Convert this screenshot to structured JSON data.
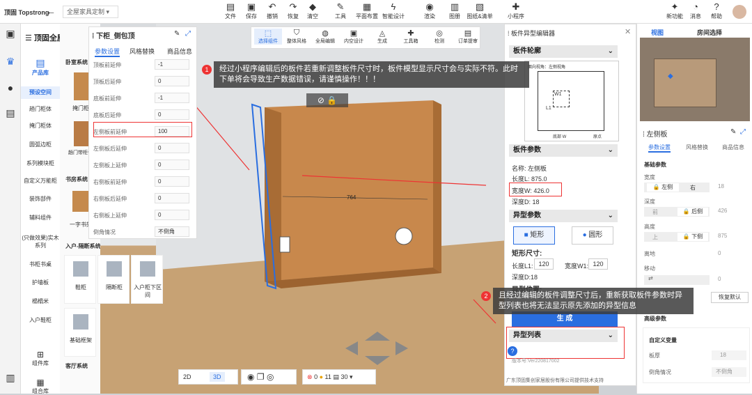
{
  "topbar": {
    "brand": "顶固 Topstrong",
    "back_icon": "arrow-left-icon",
    "breadcrumb": "全屋家具定制",
    "tools": [
      {
        "label": "文件",
        "icon": "file-icon"
      },
      {
        "label": "保存",
        "icon": "save-icon"
      },
      {
        "label": "撤销",
        "icon": "undo-icon"
      },
      {
        "label": "恢复",
        "icon": "redo-icon"
      },
      {
        "label": "清空",
        "icon": "clear-icon"
      },
      {
        "label": "工具",
        "icon": "wrench-icon"
      },
      {
        "label": "平面布置",
        "icon": "layout-icon"
      },
      {
        "label": "智能设计",
        "icon": "lightning-icon"
      },
      {
        "label": "渲染",
        "icon": "camera-icon"
      },
      {
        "label": "图册",
        "icon": "album-icon"
      },
      {
        "label": "图纸&清单",
        "icon": "drawings-icon"
      },
      {
        "label": "小程序",
        "icon": "puzzle-icon"
      }
    ],
    "right": [
      {
        "label": "新功能",
        "icon": "new-feature-icon"
      },
      {
        "label": "消息",
        "icon": "bell-icon"
      },
      {
        "label": "帮助",
        "icon": "help-icon"
      }
    ]
  },
  "left": {
    "title": "顶固全屋定制",
    "categories": [
      "产品库",
      "预设空间",
      "趟门柜体",
      "掩门柜体",
      "圆弧边柜",
      "系列模块柜",
      "自定义万能柜",
      "装饰部件",
      "辅料组件",
      "(只做效果)实木系列",
      "书柜书桌",
      "护墙板",
      "榻榻米",
      "入户鞋柜",
      "组件库",
      "组合库"
    ],
    "sections": [
      "卧室系统",
      "书房系统",
      "入户-隔断系统",
      "客厅系统"
    ],
    "products": [
      "掩门柜",
      "趟门带柜件",
      "一字书架",
      "鞋柜",
      "隔断柜",
      "入户柜下区间",
      "基础框架"
    ]
  },
  "param_panel": {
    "title": "下柜_侧包顶",
    "tabs": [
      "参数设置",
      "风格替换",
      "商品信息"
    ],
    "rows": [
      {
        "label": "顶板前延伸",
        "value": "-1"
      },
      {
        "label": "顶板后延伸",
        "value": "0"
      },
      {
        "label": "底板前延伸",
        "value": "-1"
      },
      {
        "label": "底板后延伸",
        "value": "0"
      },
      {
        "label": "左侧板前延伸",
        "value": "100"
      },
      {
        "label": "左侧板后延伸",
        "value": "0"
      },
      {
        "label": "左侧板上延伸",
        "value": "0"
      },
      {
        "label": "右侧板前延伸",
        "value": "0"
      },
      {
        "label": "右侧板后延伸",
        "value": "0"
      },
      {
        "label": "右侧板上延伸",
        "value": "0"
      },
      {
        "label": "倒角情况",
        "value": "不倒角"
      }
    ]
  },
  "toolbar2": [
    {
      "label": "选择组件",
      "icon": "select-icon"
    },
    {
      "label": "整体风格",
      "icon": "brush-icon"
    },
    {
      "label": "全局编辑",
      "icon": "globe-icon"
    },
    {
      "label": "内空设计",
      "icon": "box-icon"
    },
    {
      "label": "生成",
      "icon": "generate-icon"
    },
    {
      "label": "工具箱",
      "icon": "toolbox-icon"
    },
    {
      "label": "检测",
      "icon": "check-icon"
    },
    {
      "label": "订单提审",
      "icon": "order-icon"
    }
  ],
  "notes": {
    "n1": "经过小程序编辑后的板件若重新调整板件尺寸时，板件模型显示尺寸会与实际不符。此时下单将会导致生产数据错误，请谨慎操作！！！",
    "n2": "且经过编辑的板件调整尺寸后，重新获取板件参数时异型列表也将无法显示原先添加的异型信息",
    "b1": "1",
    "b2": "2"
  },
  "scene": {
    "dim": "764",
    "view2d": "2D",
    "view3d": "3D",
    "err": "0",
    "warn": "11",
    "count": "30"
  },
  "editor": {
    "title": "板件异型编辑器",
    "sec_outline": "板件轮廓",
    "diagram": {
      "view": "面向视角：左侧视角",
      "w": "W1",
      "l": "L1",
      "d": "底部 W",
      "o": "原点"
    },
    "sec_params": "板件参数",
    "name": "名称:  左侧板",
    "length": "长度L:  875.0",
    "width": "宽度W:  426.0",
    "depth": "深度D:  18",
    "sec_special": "异型参数",
    "rect": "矩形",
    "round": "圆形",
    "rect_size": "矩形尺寸:",
    "len_l1": "长度L1:",
    "len_l1_val": "120",
    "wid_w1": "宽度W1:",
    "wid_w1_val": "120",
    "depth18": "深度D:18",
    "pos": "异型位置:",
    "generate": "生 成",
    "sec_list": "异型列表",
    "version": "版本号:Ver220817002",
    "footer": "广东顶固集创家居股份有限公司提供技术支持"
  },
  "right": {
    "view": "视图",
    "room": "房间选择",
    "board": "左侧板",
    "tabs": [
      "参数设置",
      "风格替换",
      "商品信息"
    ],
    "basic": "基础参数",
    "width": "宽度",
    "left": "左侧",
    "right_btn": "右",
    "w18": "18",
    "depth": "深度",
    "front": "前",
    "back": "后侧",
    "d426": "426",
    "height": "高度",
    "up": "上",
    "down": "下侧",
    "h875": "875",
    "ground": "离地",
    "g0": "0",
    "move": "移动",
    "m0": "0",
    "restore": "恢复默认",
    "advanced": "高级参数",
    "custom": "自定义变量",
    "thick": "板厚",
    "thick_val": "18",
    "chamfer": "倒角情况",
    "chamfer_val": "不倒角"
  }
}
